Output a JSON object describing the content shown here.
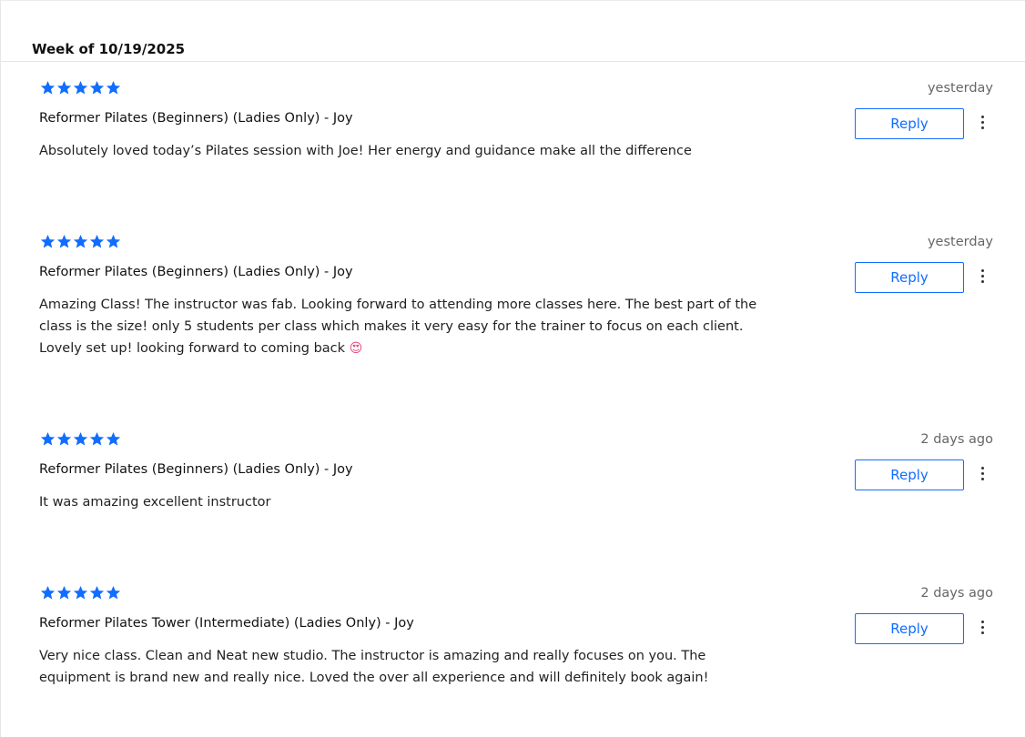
{
  "week_header": "Week of 10/19/2025",
  "accent_color": "#116dff",
  "reviews": [
    {
      "rating": 5,
      "timestamp": "yesterday",
      "class_title": "Reformer Pilates (Beginners) (Ladies Only) - Joy",
      "text": "Absolutely loved today’s Pilates session with Joe! Her energy and guidance make all the difference",
      "emoji": "",
      "reply_label": "Reply"
    },
    {
      "rating": 5,
      "timestamp": "yesterday",
      "class_title": "Reformer Pilates (Beginners) (Ladies Only) - Joy",
      "text": "Amazing Class! The instructor was fab. Looking forward to attending more classes here. The best part of the class is the size! only 5 students per class which makes it very easy for the trainer to focus on each client. Lovely set up! looking forward to coming back",
      "emoji": "😍",
      "reply_label": "Reply"
    },
    {
      "rating": 5,
      "timestamp": "2 days ago",
      "class_title": "Reformer Pilates (Beginners) (Ladies Only) - Joy",
      "text": "It was amazing excellent instructor",
      "emoji": "",
      "reply_label": "Reply"
    },
    {
      "rating": 5,
      "timestamp": "2 days ago",
      "class_title": "Reformer Pilates Tower (Intermediate) (Ladies Only) - Joy",
      "text": "Very nice class. Clean and Neat new studio. The instructor is amazing and really focuses on you. The equipment is brand new and really nice. Loved the over all experience and will definitely book again!",
      "emoji": "",
      "reply_label": "Reply"
    }
  ]
}
